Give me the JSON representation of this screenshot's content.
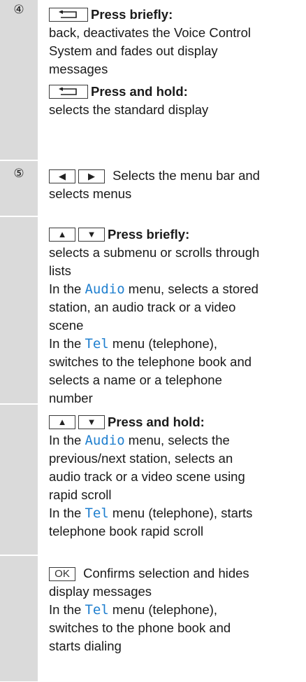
{
  "rows": [
    {
      "number": "④",
      "blocks": [
        {
          "heading": "Press briefly:",
          "lines": [
            "back, deactivates the Voice Control",
            "System and fades out display",
            "messages"
          ]
        },
        {
          "heading": "Press and hold:",
          "lines": [
            "selects the standard display"
          ]
        }
      ]
    },
    {
      "number": "⑤",
      "inline_text_1": "Selects the menu bar and",
      "inline_text_2": "selects menus"
    },
    {
      "heading": "Press briefly:",
      "lines": [
        "selects a submenu or scrolls through",
        "lists"
      ],
      "audio_pre": "In the",
      "audio_term": "Audio",
      "audio_post": "menu, selects a stored",
      "audio_lines": [
        "station, an audio track or a video",
        "scene"
      ],
      "tel_pre": "In the",
      "tel_term": "Tel",
      "tel_post": "menu (telephone),",
      "tel_lines": [
        "switches to the telephone book and",
        "selects a name or a telephone",
        "number"
      ]
    },
    {
      "heading": "Press and hold:",
      "audio_pre": "In the",
      "audio_term": "Audio",
      "audio_post": "menu, selects the",
      "audio_lines": [
        "previous/next station, selects an",
        "audio track or a video scene using",
        "rapid scroll"
      ],
      "tel_pre": "In the",
      "tel_term": "Tel",
      "tel_post": "menu (telephone), starts",
      "tel_lines": [
        "telephone book rapid scroll"
      ]
    },
    {
      "ok_label": "OK",
      "ok_text": "Confirms selection and hides",
      "ok_lines": [
        "display messages"
      ],
      "tel_pre": "In the",
      "tel_term": "Tel",
      "tel_post": "menu (telephone),",
      "tel_lines": [
        "switches to the phone book and",
        "starts dialing"
      ]
    }
  ],
  "icons": {
    "back": "back-arrow-icon",
    "left": "left-triangle-icon",
    "right": "right-triangle-icon",
    "up": "up-triangle-icon",
    "down": "down-triangle-icon"
  },
  "colors": {
    "display_term": "#1f7fcf",
    "left_column": "#dadada"
  }
}
